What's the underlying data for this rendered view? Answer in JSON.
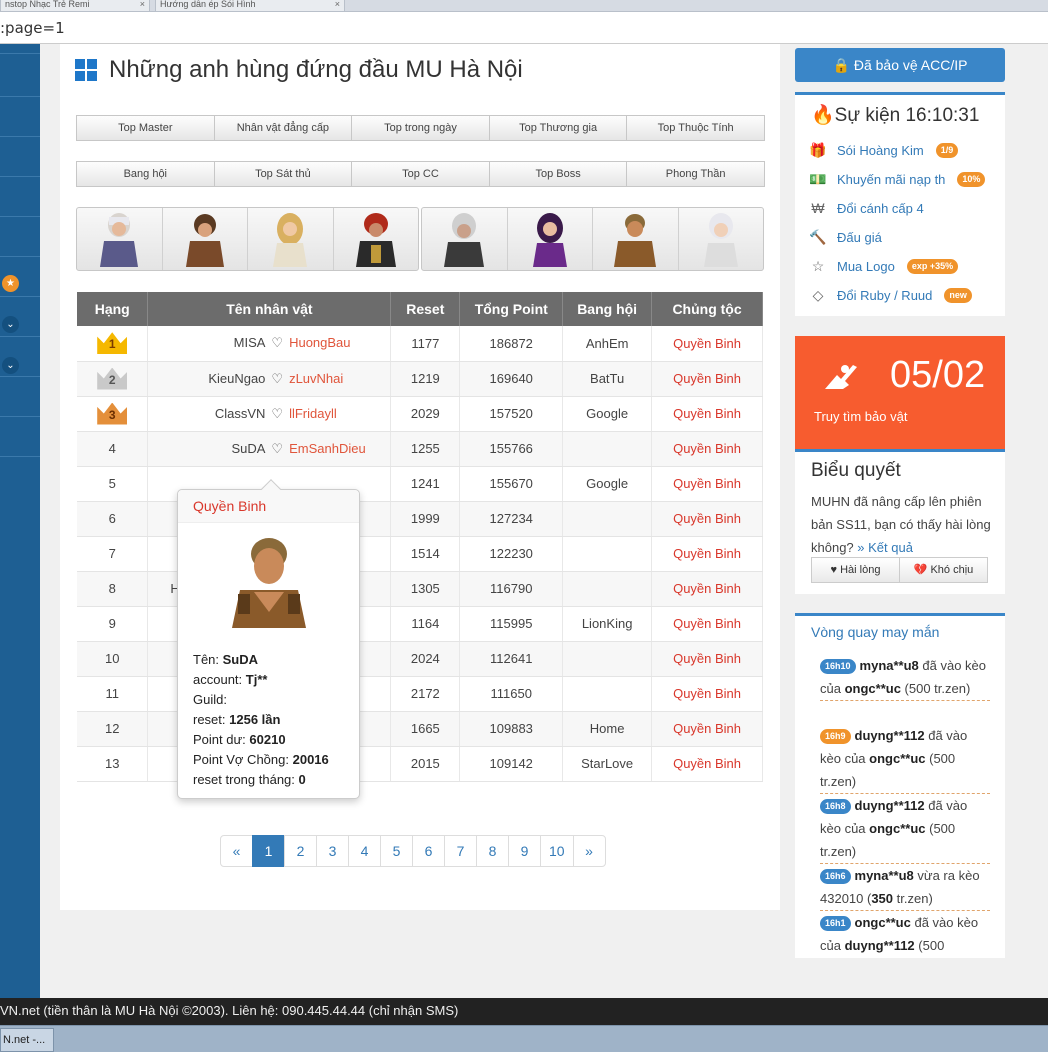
{
  "browser": {
    "tabs": [
      "nstop Nhạc Trẻ Remi",
      "Hướng dẫn ép Sói Hình"
    ],
    "url": ":page=1"
  },
  "main": {
    "title": "Những anh hùng đứng đầu MU Hà Nội",
    "tabs_row1": [
      "Top Master",
      "Nhân vật đẳng cấp",
      "Top trong ngày",
      "Top Thương gia",
      "Top Thuộc Tính"
    ],
    "tabs_row2": [
      "Bang hội",
      "Top Sát thủ",
      "Top CC",
      "Top Boss",
      "Phong Thần"
    ]
  },
  "table": {
    "headers": [
      "Hạng",
      "Tên nhân vật",
      "Reset",
      "Tổng Point",
      "Bang hội",
      "Chủng tộc"
    ],
    "rows": [
      {
        "rank": "1",
        "name": "MISA",
        "account": "HuongBau",
        "reset": "1177",
        "point": "186872",
        "guild": "AnhEm",
        "race": "Quyền Binh"
      },
      {
        "rank": "2",
        "name": "KieuNgao",
        "account": "zLuvNhai",
        "reset": "1219",
        "point": "169640",
        "guild": "BatTu",
        "race": "Quyền Binh"
      },
      {
        "rank": "3",
        "name": "ClassVN",
        "account": "llFridayll",
        "reset": "2029",
        "point": "157520",
        "guild": "Google",
        "race": "Quyền Binh"
      },
      {
        "rank": "4",
        "name": "SuDA",
        "account": "EmSanhDieu",
        "reset": "1255",
        "point": "155766",
        "guild": "",
        "race": "Quyền Binh"
      },
      {
        "rank": "5",
        "name": "",
        "account": "",
        "reset": "1241",
        "point": "155670",
        "guild": "Google",
        "race": "Quyền Binh"
      },
      {
        "rank": "6",
        "name": "",
        "account": "",
        "reset": "1999",
        "point": "127234",
        "guild": "",
        "race": "Quyền Binh"
      },
      {
        "rank": "7",
        "name": "",
        "account": "",
        "reset": "1514",
        "point": "122230",
        "guild": "",
        "race": "Quyền Binh"
      },
      {
        "rank": "8",
        "name": "H",
        "account": "",
        "reset": "1305",
        "point": "116790",
        "guild": "",
        "race": "Quyền Binh"
      },
      {
        "rank": "9",
        "name": "",
        "account": "",
        "reset": "1164",
        "point": "115995",
        "guild": "LionKing",
        "race": "Quyền Binh"
      },
      {
        "rank": "10",
        "name": "",
        "account": "",
        "reset": "2024",
        "point": "112641",
        "guild": "",
        "race": "Quyền Binh"
      },
      {
        "rank": "11",
        "name": "",
        "account": "",
        "reset": "2172",
        "point": "111650",
        "guild": "",
        "race": "Quyền Binh"
      },
      {
        "rank": "12",
        "name": "",
        "account": "",
        "reset": "1665",
        "point": "109883",
        "guild": "Home",
        "race": "Quyền Binh"
      },
      {
        "rank": "13",
        "name": "",
        "account": "",
        "reset": "2015",
        "point": "109142",
        "guild": "StarLove",
        "race": "Quyền Binh"
      }
    ]
  },
  "popup": {
    "title": "Quyền Binh",
    "name_label": "Tên:",
    "name": "SuDA",
    "account_label": "account:",
    "account": "Tj**",
    "guild_label": "Guild:",
    "reset_label": "reset:",
    "reset": "1256 lần",
    "point_label": "Point dư:",
    "point": "60210",
    "spouse_label": "Point Vợ Chồng:",
    "spouse": "20016",
    "month_label": "reset trong tháng:",
    "month": "0"
  },
  "pagination": {
    "prev": "«",
    "next": "»",
    "pages": [
      "1",
      "2",
      "3",
      "4",
      "5",
      "6",
      "7",
      "8",
      "9",
      "10"
    ],
    "current": "1"
  },
  "right": {
    "protect_button": "Đã bảo vệ ACC/IP",
    "events": {
      "title": "Sự kiện 16:10:31",
      "items": [
        {
          "label": "Sói Hoàng Kim",
          "badge": "1/9",
          "icon": "gift-icon"
        },
        {
          "label": "Khuyến mãi nạp th",
          "badge": "10%",
          "icon": "money-icon"
        },
        {
          "label": "Đổi cánh cấp 4",
          "badge": "",
          "icon": "currency-icon"
        },
        {
          "label": "Đấu giá",
          "badge": "",
          "icon": "gavel-icon"
        },
        {
          "label": "Mua Logo",
          "badge": "exp +35%",
          "icon": "star-icon"
        },
        {
          "label": "Đổi Ruby / Ruud",
          "badge": "new",
          "icon": "diamond-icon"
        }
      ]
    },
    "treasure": {
      "number": "05/02",
      "label": "Truy tìm bảo vật"
    },
    "poll": {
      "title": "Biểu quyết",
      "text": "MUHN đã nâng cấp lên phiên bản SS11, bạn có thấy hài lòng không?",
      "link": "» Kết quả",
      "btn_like": "Hài lòng",
      "btn_dislike": "Khó chịu"
    },
    "lucky": {
      "title": "Vòng quay may mắn",
      "items": [
        {
          "time": "16h10",
          "color": "#3a86c8",
          "user": "myna**u8",
          "text1": " đã vào kèo của ",
          "user2": "ongc**uc",
          "text2": " (500 tr.zen)"
        },
        {
          "time": "16h9",
          "color": "#f0932b",
          "user": "duyng**112",
          "text1": " đã vào kèo của ",
          "user2": "ongc**uc",
          "text2": " (500 tr.zen)"
        },
        {
          "time": "16h8",
          "color": "#3a86c8",
          "user": "duyng**112",
          "text1": " đã vào kèo của ",
          "user2": "ongc**uc",
          "text2": " (500 tr.zen)"
        },
        {
          "time": "16h6",
          "color": "#3a86c8",
          "user": "myna**u8",
          "text1": " vừa ra kèo 432010 (",
          "user2": "350",
          "text2": " tr.zen)"
        },
        {
          "time": "16h1",
          "color": "#3a86c8",
          "user": "ongc**uc",
          "text1": " đã vào kèo của ",
          "user2": "duyng**112",
          "text2": " (500"
        }
      ]
    }
  },
  "footer": {
    "text": "VN.net (tiền thân là MU Hà Nội ©2003). Liên hệ: 090.445.44.44 (chỉ nhận SMS)"
  },
  "taskbar": {
    "task": "N.net -..."
  }
}
